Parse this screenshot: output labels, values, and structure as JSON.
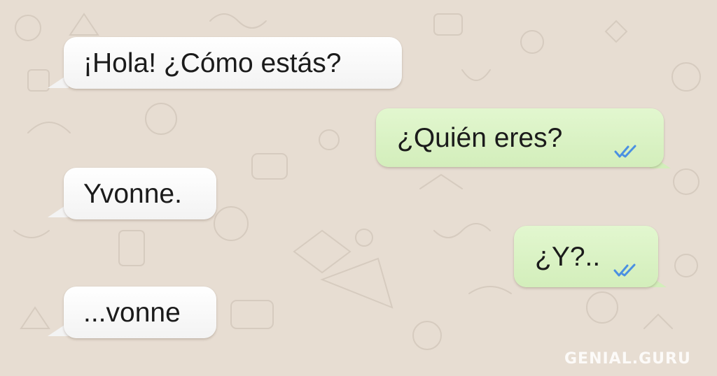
{
  "messages": [
    {
      "direction": "incoming",
      "text": "¡Hola! ¿Cómo estás?"
    },
    {
      "direction": "outgoing",
      "text": "¿Quién eres?",
      "status": "read"
    },
    {
      "direction": "incoming",
      "text": "Yvonne."
    },
    {
      "direction": "outgoing",
      "text": "¿Y?..",
      "status": "read"
    },
    {
      "direction": "incoming",
      "text": "...vonne"
    }
  ],
  "watermark": "GENIAL.GURU",
  "colors": {
    "wallpaper": "#e7ddd2",
    "incoming_bubble": "#ffffff",
    "outgoing_bubble": "#dcf4c6",
    "read_ticks": "#4a90e2"
  },
  "icons": [
    "double-check-read-icon"
  ]
}
